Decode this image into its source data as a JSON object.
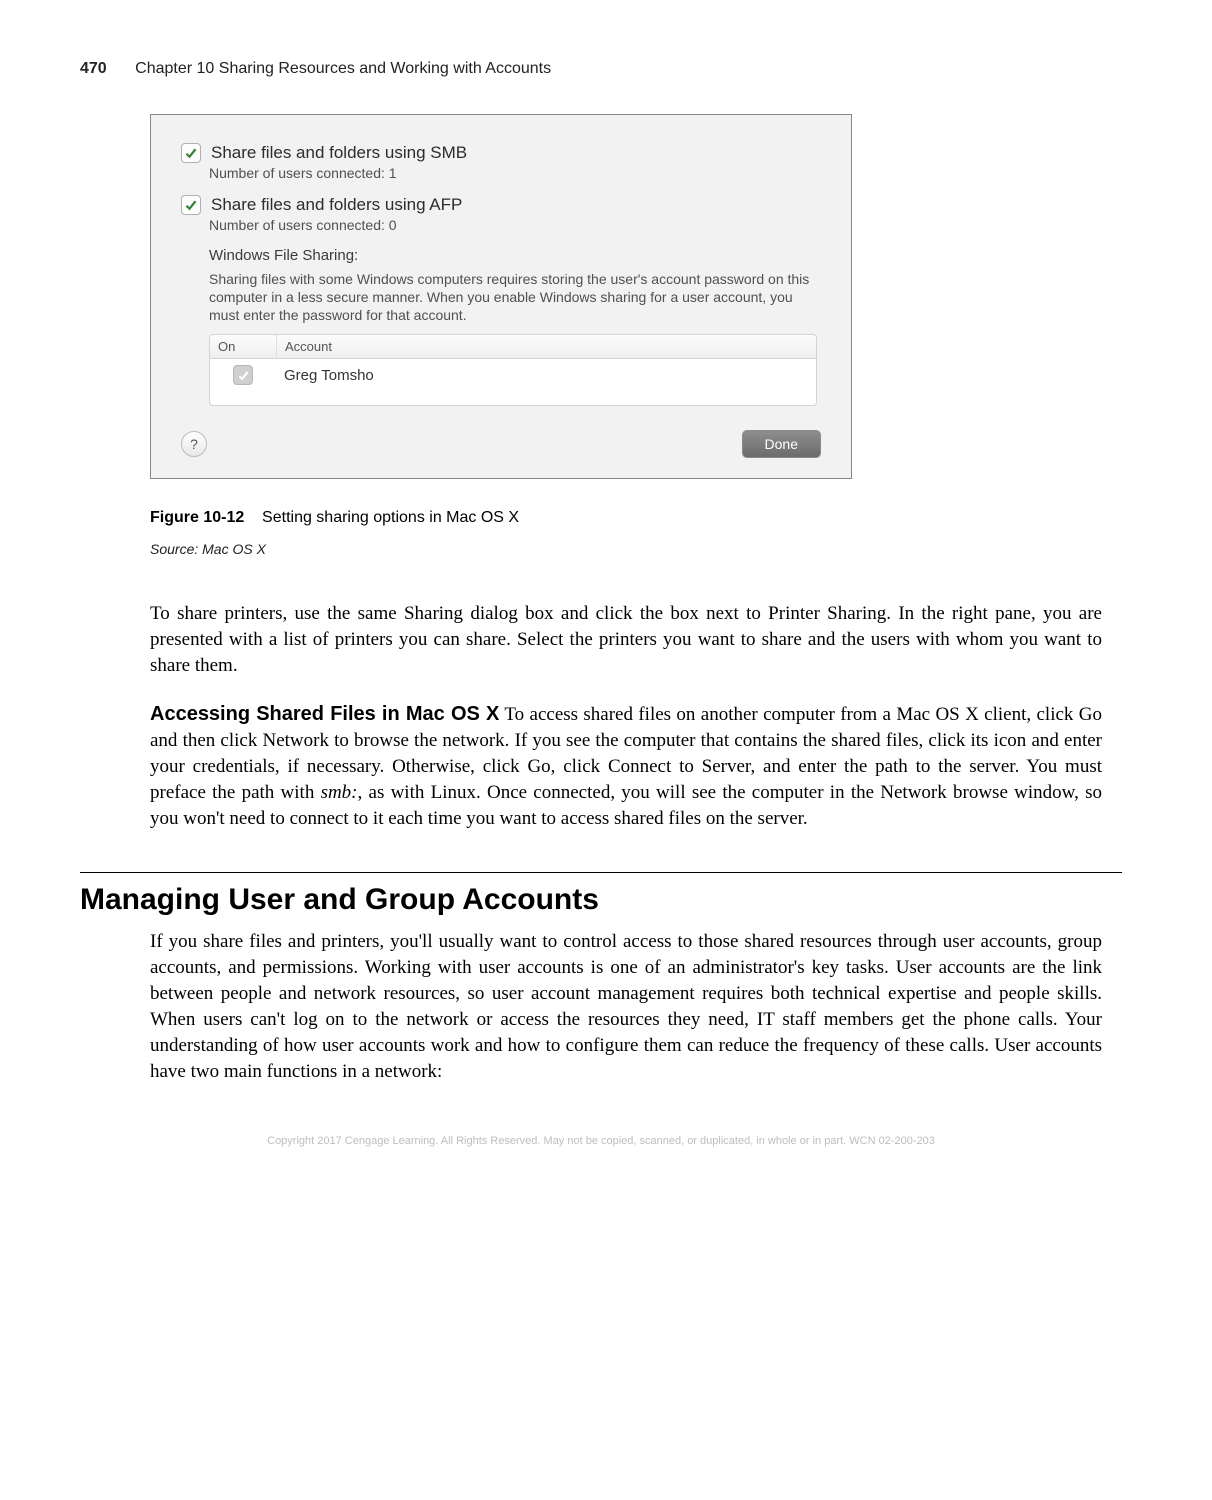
{
  "header": {
    "page_number": "470",
    "chapter": "Chapter 10   Sharing Resources and Working with Accounts"
  },
  "dialog": {
    "smb_label": "Share files and folders using SMB",
    "smb_sub": "Number of users connected: 1",
    "afp_label": "Share files and folders using AFP",
    "afp_sub": "Number of users connected: 0",
    "wfs_heading": "Windows File Sharing:",
    "wfs_text": "Sharing files with some Windows computers requires storing the user's account password on this computer in a less secure manner.  When you enable Windows sharing for a user account, you must enter the password for that account.",
    "table": {
      "col_on": "On",
      "col_account": "Account",
      "rows": [
        {
          "name": "Greg Tomsho"
        }
      ]
    },
    "help": "?",
    "done": "Done"
  },
  "figure": {
    "label": "Figure 10-12",
    "caption": "Setting sharing options in Mac OS X",
    "source": "Source: Mac OS X"
  },
  "para1": "To share printers, use the same Sharing dialog box and click the box next to Printer Sharing. In the right pane, you are presented with a list of printers you can share. Select the printers you want to share and the users with whom you want to share them.",
  "para2_runin": "Accessing Shared Files in Mac OS X",
  "para2_a": " To access shared files on another computer from a Mac OS X client, click Go and then click Network to browse the network. If you see the computer that contains the shared files, click its icon and enter your credentials, if necessary. Otherwise, click Go, click Connect to Server, and enter the path to the server. You must preface the path with ",
  "para2_ital": "smb:",
  "para2_b": ", as with Linux. Once connected, you will see the computer in the Network browse window, so you won't need to connect to it each time you want to access shared files on the server.",
  "section": {
    "heading": "Managing User and Group Accounts",
    "body": "If you share files and printers, you'll usually want to control access to those shared resources through user accounts, group accounts, and permissions. Working with user accounts is one of an administrator's key tasks. User accounts are the link between people and network resources, so user account management requires both technical expertise and people skills. When users can't log on to the network or access the resources they need, IT staff members get the phone calls. Your understanding of how user accounts work and how to configure them can reduce the frequency of these calls. User accounts have two main functions in a network:"
  },
  "copyright": "Copyright 2017 Cengage Learning. All Rights Reserved. May not be copied, scanned, or duplicated, in whole or in part.  WCN 02-200-203"
}
